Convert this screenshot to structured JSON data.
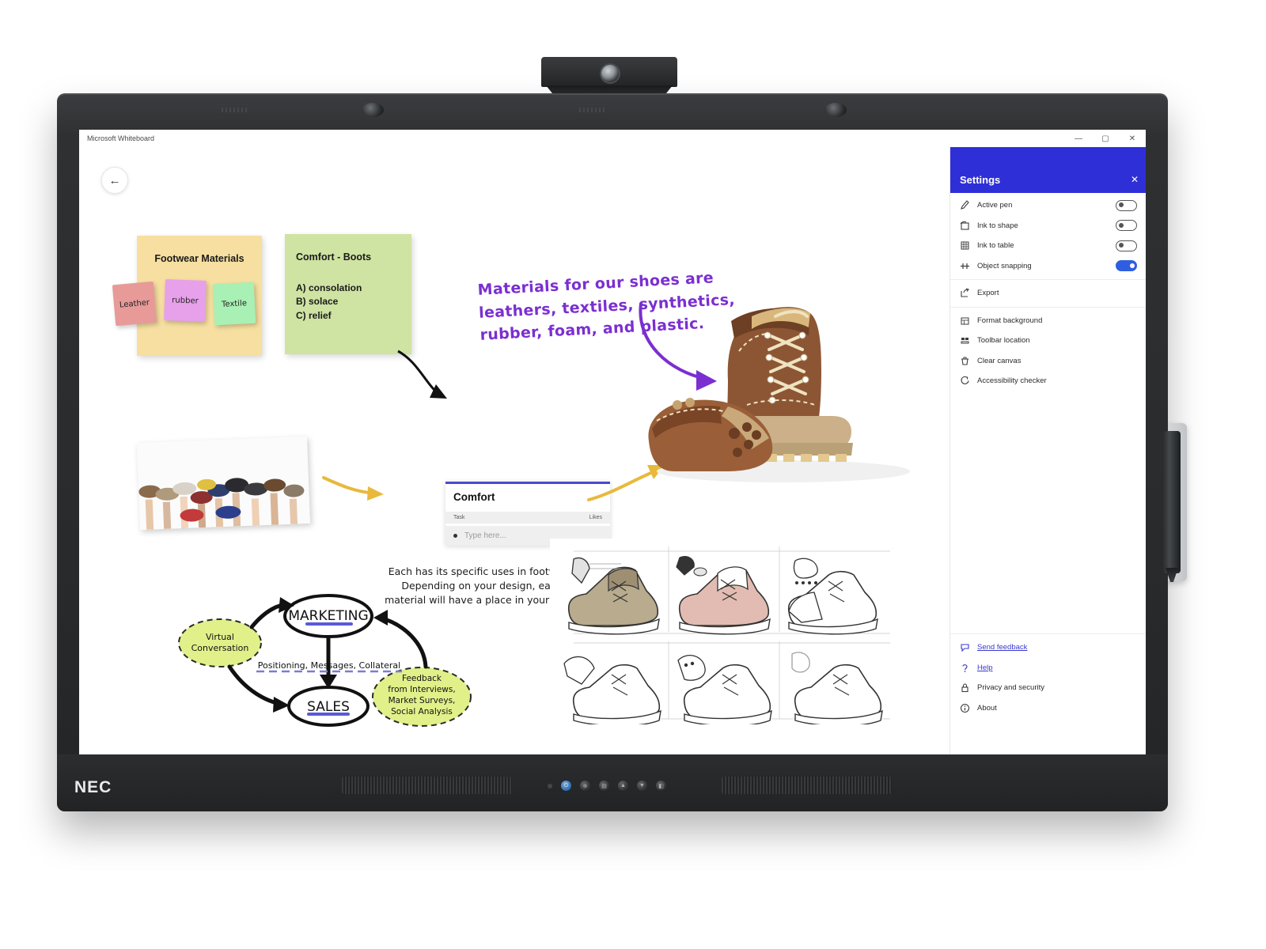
{
  "hardware": {
    "brand": "NEC",
    "webcam_name": "webcam-module",
    "buttons": [
      "power",
      "input",
      "menu",
      "up",
      "down",
      "mute"
    ]
  },
  "window": {
    "title": "Microsoft Whiteboard",
    "controls": {
      "minimize": "—",
      "maximize": "▢",
      "close": "✕"
    }
  },
  "canvas": {
    "back_button": "←",
    "yellow_board": {
      "title": "Footwear Materials",
      "notes": [
        {
          "label": "Leather",
          "color": "#e79a98"
        },
        {
          "label": "rubber",
          "color": "#e7a0ea"
        },
        {
          "label": "Textile",
          "color": "#a9f0b4"
        }
      ]
    },
    "green_board": {
      "title": "Comfort - Boots",
      "items": [
        "A) consolation",
        "B) solace",
        "C) relief"
      ]
    },
    "purple_note": "Materials for our shoes are leathers, textiles, synthetics, rubber, foam, and plastic.",
    "black_note": "Each has its specific uses in footwear. Depending on your design, each material will have a place in your shoe.",
    "comfort_widget": {
      "title": "Comfort",
      "columns": [
        "Task",
        "Likes"
      ],
      "row_placeholder": "Type here..."
    },
    "diagram": {
      "nodes": [
        "MARKETING",
        "SALES"
      ],
      "bubbles": [
        "Virtual Conversation",
        "Feedback from Interviews, Market Surveys, Social Analysis"
      ],
      "connector_label": "Positioning, Messages, Collateral"
    },
    "images": {
      "hands_photo": "photo-hands-holding-shoes",
      "boots_photo": "photo-brown-leather-boots",
      "sketches": "shoe-design-sketch-grid"
    }
  },
  "toolbar": {
    "select_tool": "✓",
    "tools": [
      {
        "name": "text-tool",
        "color": "#ffffff"
      },
      {
        "name": "pen-red",
        "color": "#9c2727"
      },
      {
        "name": "pen-blue",
        "color": "#2b3f9c"
      },
      {
        "name": "pen-green",
        "color": "#2d6b3e"
      },
      {
        "name": "pen-orange",
        "color": "#b05c22"
      },
      {
        "name": "pen-navy",
        "color": "#2a3570"
      },
      {
        "name": "pen-yellow",
        "color": "#c9a227"
      },
      {
        "name": "eraser-tool",
        "color": "#e9b9d8"
      },
      {
        "name": "sticky-note-tool",
        "color": "#7a7a7a"
      },
      {
        "name": "shape-tool",
        "color": "#7a7a7a"
      },
      {
        "name": "undo-tool",
        "color": "#7a7a7a"
      },
      {
        "name": "redo-tool",
        "color": "#7a7a7a"
      }
    ]
  },
  "settings": {
    "header": "Settings",
    "close": "✕",
    "toggle_items": [
      {
        "label": "Active pen",
        "icon": "pen-icon",
        "state": "off"
      },
      {
        "label": "Ink to shape",
        "icon": "ink-to-shape-icon",
        "state": "off"
      },
      {
        "label": "Ink to table",
        "icon": "table-icon",
        "state": "off"
      },
      {
        "label": "Object snapping",
        "icon": "snap-icon",
        "state": "on"
      }
    ],
    "action_items": [
      {
        "label": "Export",
        "icon": "export-icon"
      },
      {
        "label": "Format background",
        "icon": "background-icon"
      },
      {
        "label": "Toolbar location",
        "icon": "toolbar-icon"
      },
      {
        "label": "Clear canvas",
        "icon": "trash-icon"
      },
      {
        "label": "Accessibility checker",
        "icon": "accessibility-icon"
      }
    ],
    "footer_items": [
      {
        "label": "Send feedback",
        "icon": "feedback-icon",
        "link": true
      },
      {
        "label": "Help",
        "icon": "help-icon",
        "link": true
      },
      {
        "label": "Privacy and security",
        "icon": "lock-icon",
        "link": false
      },
      {
        "label": "About",
        "icon": "info-icon",
        "link": false
      }
    ],
    "accent_color": "#2f2fd8",
    "toggle_on_color": "#2f5fe0"
  }
}
